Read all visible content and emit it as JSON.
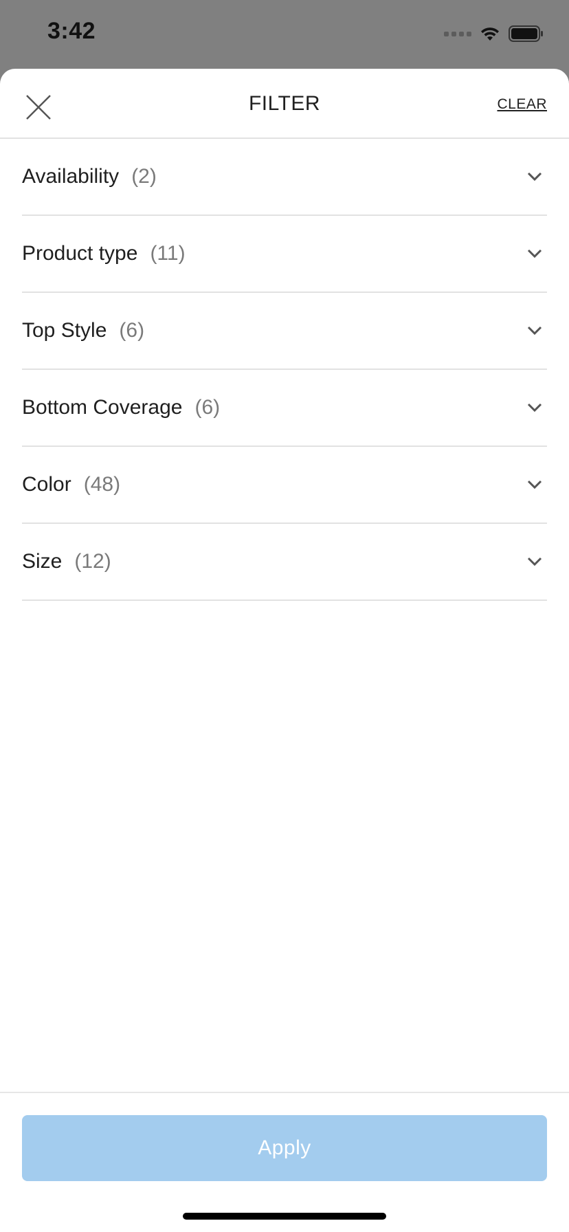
{
  "status_bar": {
    "time": "3:42"
  },
  "header": {
    "title": "FILTER",
    "clear_label": "CLEAR"
  },
  "filters": [
    {
      "label": "Availability",
      "count": "(2)"
    },
    {
      "label": "Product type",
      "count": "(11)"
    },
    {
      "label": "Top Style",
      "count": "(6)"
    },
    {
      "label": "Bottom Coverage",
      "count": "(6)"
    },
    {
      "label": "Color",
      "count": "(48)"
    },
    {
      "label": "Size",
      "count": "(12)"
    }
  ],
  "footer": {
    "apply_label": "Apply"
  },
  "colors": {
    "apply_disabled": "#a3ccee",
    "divider": "#e2e2e2",
    "overlay": "#808080"
  }
}
